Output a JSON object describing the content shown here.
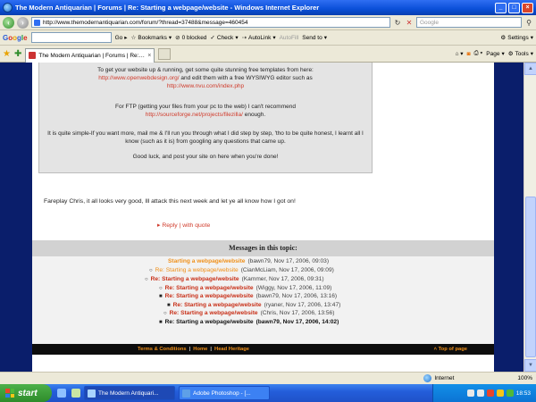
{
  "window": {
    "title": "The Modern Antiquarian | Forums | Re: Starting a webpage/website - Windows Internet Explorer"
  },
  "address": {
    "url": "http://www.themodernantiquarian.com/forum/?thread=37488&message=460454",
    "search_placeholder": "Google"
  },
  "google_toolbar": {
    "go_label": "Go",
    "bookmarks_label": "Bookmarks",
    "blocked_label": "0 blocked",
    "check_label": "Check",
    "autolink_label": "AutoLink",
    "autofill_label": "AutoFill",
    "sendto_label": "Send to",
    "settings_label": "Settings"
  },
  "tabs": {
    "active_label": "The Modern Antiquarian | Forums | Re: Starting a w...",
    "page_label": "Page",
    "tools_label": "Tools"
  },
  "quote": {
    "p1_a": "To get your website up & running, get some quite stunning free templates from here:",
    "p1_link1": "http://www.openwebdesign.org/",
    "p1_b": " and edit them with a free WYSIWYG editor such as",
    "p1_link2": "http://www.nvu.com/index.php",
    "p2_a": "For FTP (getting your files from your pc to the web) I can't recommend",
    "p2_link": "http://sourceforge.net/projects/filezilla/",
    "p2_b": " enough.",
    "p3": "It is quite simple-If you want more, mail me & I'll run you through what I did step by step, 'tho to be quite honest, I learnt all I know (such as it is) from googling any questions that came up.",
    "p4": "Good luck, and post your site on here when you're done!"
  },
  "reply": {
    "text": "Fareplay Chris, it all looks very good, Ill attack this next week and let ye all know how I got on!",
    "reply_link": "Reply",
    "quote_link": "with quote",
    "sep": "|",
    "arrow": "▸"
  },
  "topic": {
    "header": "Messages in this topic:",
    "items": [
      {
        "bullet": "",
        "title": "Starting a webpage/website",
        "meta": "(bawn79, Nov 17, 2006, 09:03)",
        "color": "#f0901a",
        "bold": true
      },
      {
        "bullet": "○",
        "title": "Re: Starting a webpage/website",
        "meta": "(CianMcLiam, Nov 17, 2006, 09:09)",
        "color": "#f0901a",
        "bold": false
      },
      {
        "bullet": "○",
        "title": "Re: Starting a webpage/website",
        "meta": "(Kammer, Nov 17, 2006, 09:31)",
        "color": "#c83018",
        "bold": true
      },
      {
        "bullet": "○",
        "title": "Re: Starting a webpage/website",
        "meta": "(Wiggy, Nov 17, 2006, 11:09)",
        "color": "#c83018",
        "bold": true
      },
      {
        "bullet": "■",
        "title": "Re: Starting a webpage/website",
        "meta": "(bawn79, Nov 17, 2006, 13:16)",
        "color": "#c83018",
        "bold": true
      },
      {
        "bullet": "■",
        "title": "Re: Starting a webpage/website",
        "meta": "(ryaner, Nov 17, 2006, 13:47)",
        "color": "#c83018",
        "bold": true
      },
      {
        "bullet": "○",
        "title": "Re: Starting a webpage/website",
        "meta": "(Chris, Nov 17, 2006, 13:56)",
        "color": "#c83018",
        "bold": true
      },
      {
        "bullet": "■",
        "title": "Re: Starting a webpage/website",
        "meta": "(bawn79, Nov 17, 2006, 14:02)",
        "color": "#111111",
        "bold": true
      }
    ]
  },
  "footer": {
    "terms": "Terms & Conditions",
    "home": "Home",
    "heritage": "Head Heritage",
    "sep": "|",
    "top": "˄ Top of page"
  },
  "status": {
    "zone": "Internet",
    "zoom": "100%"
  },
  "taskbar": {
    "start_label": "start",
    "task1": "The Modern Antiquari...",
    "task2": "Adobe Photoshop - [...",
    "clock": "18:53"
  },
  "icons": {
    "back": "back-arrow-icon",
    "forward": "forward-arrow-icon",
    "refresh": "refresh-icon",
    "stop": "stop-icon",
    "search": "search-icon",
    "favorites": "star-icon",
    "home": "home-icon",
    "print": "print-icon"
  }
}
